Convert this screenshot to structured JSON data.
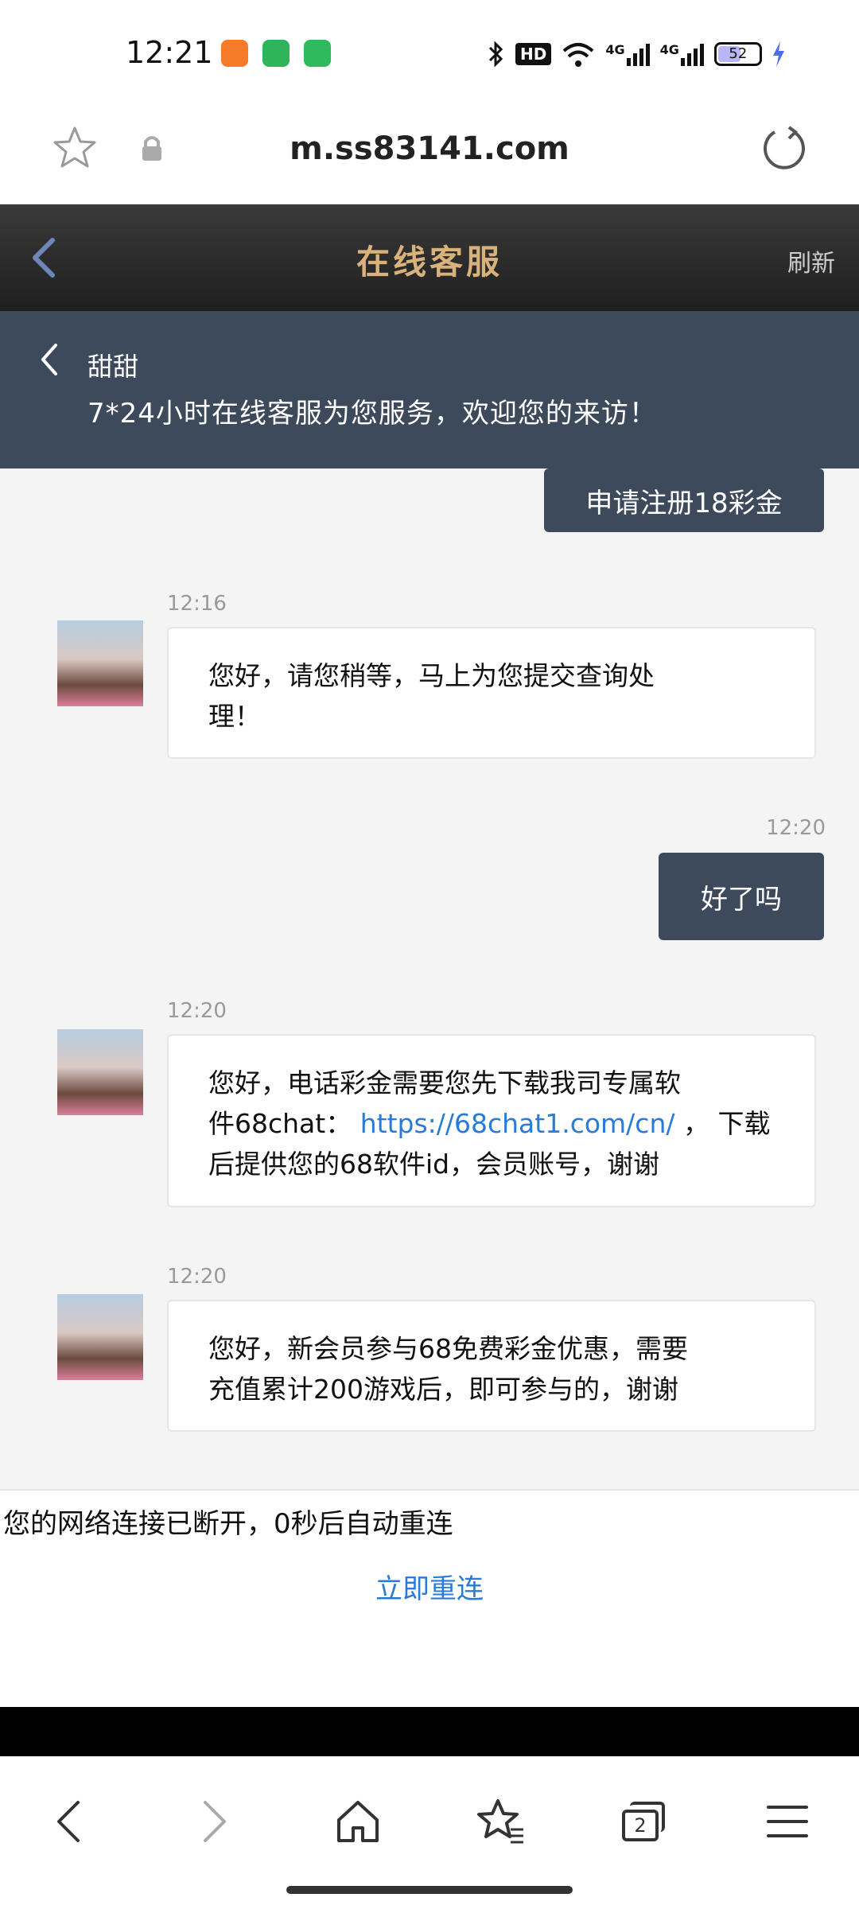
{
  "status_bar": {
    "time": "12:21",
    "network_1": "4G",
    "network_2": "4G",
    "hd_label": "HD",
    "battery": "52"
  },
  "browser": {
    "url": "m.ss83141.com"
  },
  "header": {
    "title": "在线客服",
    "refresh_label": "刷新"
  },
  "agent": {
    "name": "甜甜",
    "subtitle": "7*24小时在线客服为您服务，欢迎您的来访！"
  },
  "messages": [
    {
      "from": "user",
      "time": "",
      "text": "申请注册18彩金"
    },
    {
      "from": "agent",
      "time": "12:16",
      "line1": "您好，请您稍等，马上为您提交查询处",
      "line2": "理！"
    },
    {
      "from": "user",
      "time": "12:20",
      "text": "好了吗"
    },
    {
      "from": "agent",
      "time": "12:20",
      "line1": "您好，电话彩金需要您先下载我司专属软",
      "line2_pre": "件68chat：",
      "line2_link": "https://68chat1.com/cn/",
      "line2_post": "，  下载",
      "line3": "后提供您的68软件id，会员账号，谢谢"
    },
    {
      "from": "agent",
      "time": "12:20",
      "line1": "您好，新会员参与68免费彩金优惠，需要",
      "line2": "充值累计200游戏后，即可参与的，谢谢"
    }
  ],
  "disconnect": {
    "message": "您的网络连接已断开，0秒后自动重连",
    "reconnect_label": "立即重连"
  },
  "bottom_nav": {
    "tabs_count": "2"
  },
  "colors": {
    "header_bg": "#1f1f1f",
    "header_title": "#d8b27a",
    "agent_bar_bg": "#3c4a5c",
    "user_bubble_bg": "#3d4a5c",
    "link": "#2a7ad8"
  }
}
